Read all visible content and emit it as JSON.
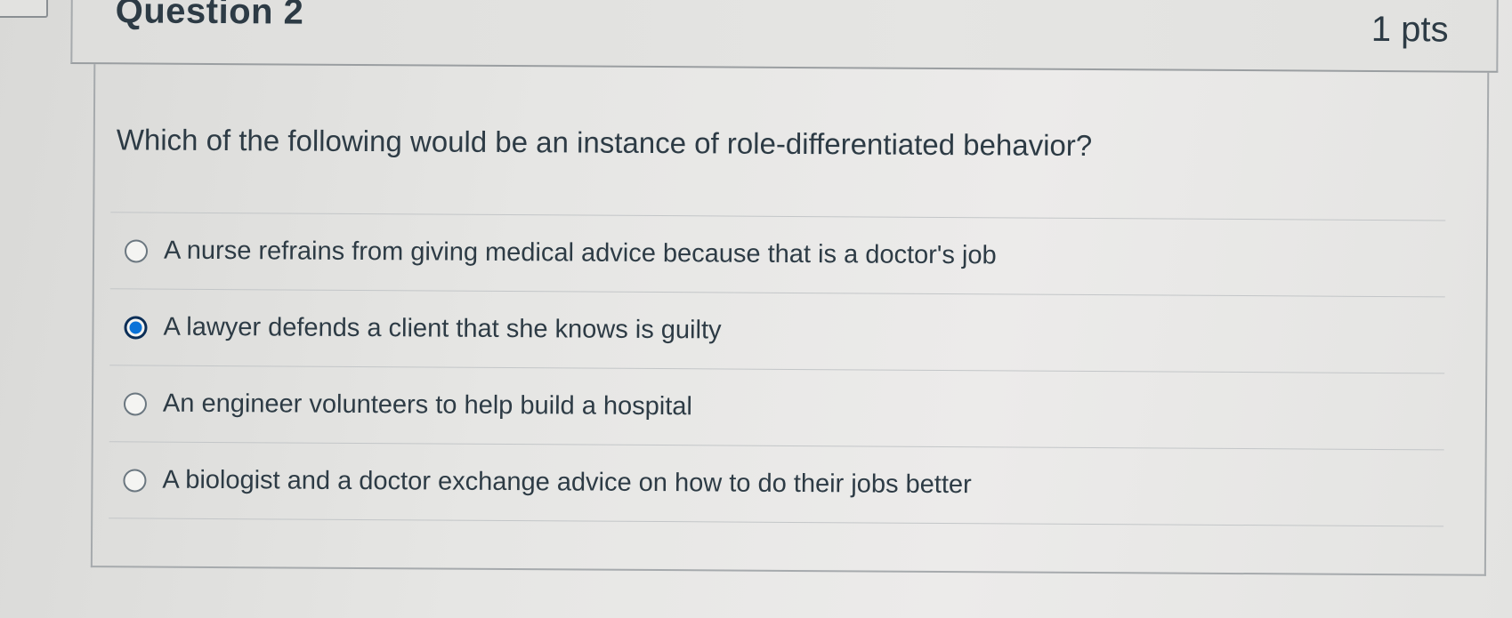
{
  "question": {
    "name": "Question 2",
    "points": "1 pts",
    "text": "Which of the following would be an instance of role-differentiated behavior?"
  },
  "answers": [
    {
      "label": "A nurse refrains from giving medical advice because that is a doctor's job",
      "selected": false
    },
    {
      "label": "A lawyer defends a client that she knows is guilty",
      "selected": true
    },
    {
      "label": "An engineer volunteers to help build a hospital",
      "selected": false
    },
    {
      "label": "A biologist and a doctor exchange advice on how to do their jobs better",
      "selected": false
    }
  ],
  "colors": {
    "text": "#2d3b45",
    "radio_selected": "#0b73d8",
    "border": "#a6aaad"
  }
}
